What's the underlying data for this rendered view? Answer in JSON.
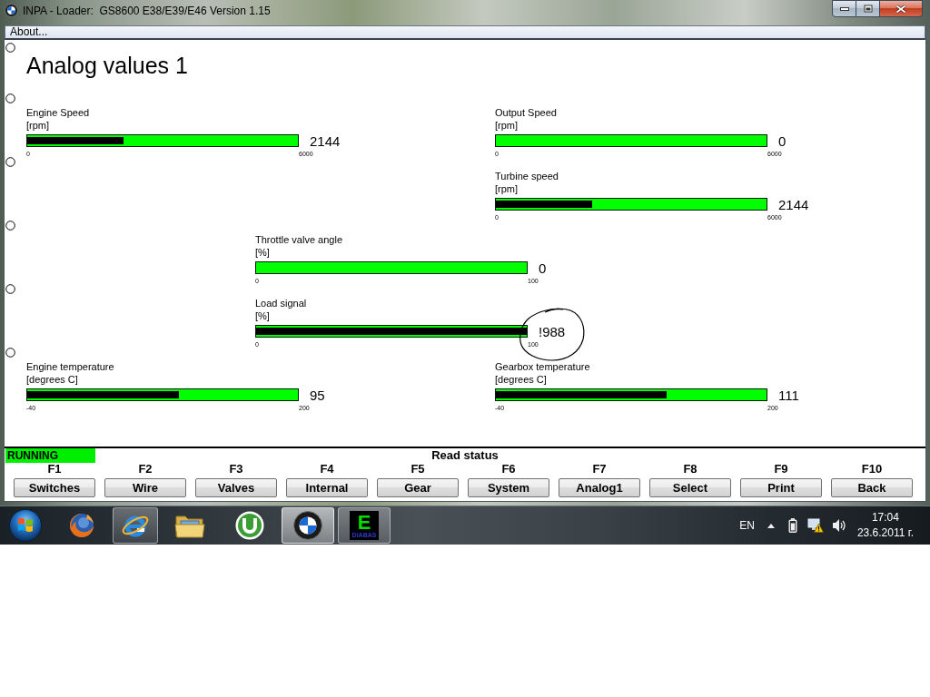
{
  "window": {
    "title": "INPA - Loader:  GS8600 E38/E39/E46 Version 1.15"
  },
  "menu": [
    "About..."
  ],
  "page_title": "Analog values 1",
  "gauge_rows": [
    {
      "left": {
        "name": "Engine Speed",
        "unit": "[rpm]",
        "level": 0.357,
        "value": "2144",
        "min": "0",
        "max": "6000",
        "circled": false
      },
      "right": {
        "name": "Output Speed",
        "unit": "[rpm]",
        "level": 0,
        "value": "0",
        "min": "0",
        "max": "6000",
        "circled": false
      }
    },
    {
      "right": {
        "name": "Turbine speed",
        "unit": "[rpm]",
        "level": 0.357,
        "value": "2144",
        "min": "0",
        "max": "6000",
        "circled": false
      }
    },
    {
      "middle": {
        "name": "Throttle valve angle",
        "unit": "[%]",
        "level": 0,
        "value": "0",
        "min": "0",
        "max": "100",
        "circled": false
      }
    },
    {
      "middle": {
        "name": "Load signal",
        "unit": "[%]",
        "level": 1,
        "value": "!988",
        "min": "0",
        "max": "100",
        "circled": true
      }
    },
    {
      "left": {
        "name": "Engine temperature",
        "unit": "[degrees C]",
        "level": 0.56,
        "value": "95",
        "min": "-40",
        "max": "200",
        "circled": false
      },
      "right": {
        "name": "Gearbox temperature",
        "unit": "[degrees C]",
        "level": 0.63,
        "value": "111",
        "min": "-40",
        "max": "200",
        "circled": false
      }
    }
  ],
  "status": {
    "label": "RUNNING",
    "running": true,
    "message": "Read status"
  },
  "function_keys": [
    {
      "key": "F1",
      "label": "Switches"
    },
    {
      "key": "F2",
      "label": "Wire"
    },
    {
      "key": "F3",
      "label": "Valves"
    },
    {
      "key": "F4",
      "label": "Internal"
    },
    {
      "key": "F5",
      "label": "Gear"
    },
    {
      "key": "F6",
      "label": "System"
    },
    {
      "key": "F7",
      "label": "Analog1"
    },
    {
      "key": "F8",
      "label": "Select"
    },
    {
      "key": "F9",
      "label": "Print"
    },
    {
      "key": "F10",
      "label": "Back"
    }
  ],
  "taskbar": {
    "apps": [
      {
        "kind": "firefox",
        "running": false,
        "selected": false
      },
      {
        "kind": "ie",
        "running": true,
        "selected": false
      },
      {
        "kind": "explorer",
        "running": false,
        "selected": false
      },
      {
        "kind": "utorrent",
        "running": false,
        "selected": false
      },
      {
        "kind": "bmw",
        "running": true,
        "selected": true
      },
      {
        "kind": "ediabas",
        "running": true,
        "selected": false,
        "logo_letter": "E",
        "logo_caption": "DIABAS"
      }
    ],
    "language": "EN",
    "time": "17:04",
    "date": "23.6.2011 г."
  }
}
